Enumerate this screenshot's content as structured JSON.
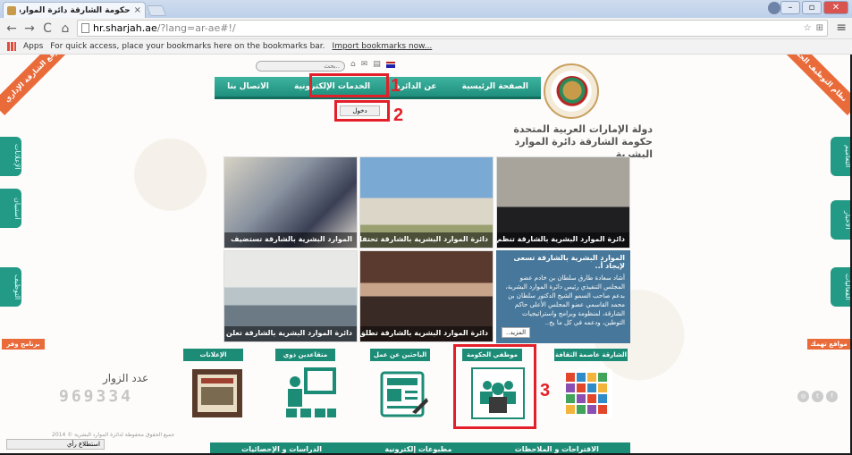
{
  "browser": {
    "tab_title": "حكومة الشارقة دائرة الموارد ا",
    "close_glyph": "×",
    "url_host": "hr.sharjah.ae",
    "url_path": "/?lang=ar-ae#!/",
    "bookmarks": {
      "apps": "Apps",
      "hint": "For quick access, place your bookmarks here on the bookmarks bar.",
      "import": "Import bookmarks now..."
    },
    "window_controls": {
      "min": "–",
      "max": "▫",
      "close": "✕"
    },
    "nav": {
      "back": "←",
      "forward": "→",
      "reload": "C",
      "home": "⌂"
    },
    "menu": "≡"
  },
  "page": {
    "search_placeholder": "بحث..",
    "nav_items": [
      {
        "label": "الصفحة الرئيسية"
      },
      {
        "label": "عن الدائرة"
      },
      {
        "label": "الخدمات الإلكترونية"
      },
      {
        "label": "الاتصال بنا"
      }
    ],
    "nav_sub_login": "دخول",
    "gov_title_line1": "دولة الإمارات العربية المتحدة",
    "gov_title_line2": "حكومة الشارقة دائرة الموارد البشرية",
    "ribbon_left": "موقع الشارقة الإداري",
    "ribbon_right": "نظام التوظيف الجديد",
    "tiles": [
      {
        "caption": "الموارد البشرية بالشارقة تستضيف"
      },
      {
        "caption": "دائرة الموارد البشرية بالشارقة تحتفل بـ.."
      },
      {
        "caption": "دائرة الموارد البشرية بالشارقة تنظم بر.."
      },
      {
        "caption": "دائرة الموارد البشرية بالشارقة تعلن عن.."
      },
      {
        "caption": "دائرة الموارد البشرية بالشارقة تطلق بر.."
      }
    ],
    "news": {
      "headline": "الموارد البشرية بالشارقة تسعى لإيجاد أ..",
      "body": "أشاد سعادة طارق سلطان بن خادم عضو المجلس التنفيذي رئيس دائرة الموارد البشرية، بدعم صاحب السمو الشيخ الدكتور سلطان بن محمد القاسمي عضو المجلس الأعلى حاكم الشارقة، لمنظومة وبرامج واستراتيجيات التوطين، ودعمه في كل ما يخ..",
      "more": "المزيد.."
    },
    "services": [
      {
        "label": "الإعلانات"
      },
      {
        "label": "متقاعدين ذوي الخبرة"
      },
      {
        "label": "الباحثين عن عمل"
      },
      {
        "label": "موظفي الحكومة"
      },
      {
        "label": "الشارقة عاصمة الثقافة الإسلامية"
      }
    ],
    "visitors_label": "عدد الزوار",
    "visitors_count": "969334",
    "ribbon_bottom_left": "برنامج وفر",
    "ribbon_bottom_right": "مواقع تهمك",
    "copyright": "جميع الحقوق محفوظة لدائرة الموارد البشرية © 2014",
    "survey": "استطلاع رأي",
    "footer_links": [
      {
        "label": "الاقتراحات و الملاحظات"
      },
      {
        "label": "مطبوعات إلكترونية"
      },
      {
        "label": "الدراسات و الإحصائيات"
      }
    ],
    "side_tabs_left": [
      "الإعلانات",
      "استبيان",
      "التوظيف"
    ],
    "side_tabs_right": [
      "التعاميم",
      "الأخبار",
      "الفعاليات"
    ]
  },
  "annotations": {
    "label_1": "1",
    "label_2": "2",
    "label_3": "3",
    "color": "#e3202a"
  },
  "colors": {
    "teal": "#1d8c77",
    "orange": "#ea6b3a"
  }
}
